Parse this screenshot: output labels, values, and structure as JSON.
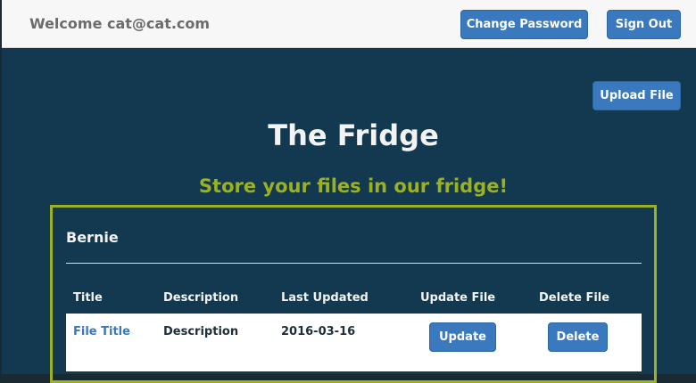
{
  "header": {
    "welcome": "Welcome cat@cat.com",
    "change_password_label": "Change Password",
    "sign_out_label": "Sign Out"
  },
  "main": {
    "upload_label": "Upload File",
    "title": "The Fridge",
    "subtitle": "Store your files in our fridge!"
  },
  "panel": {
    "title": "Bernie",
    "columns": [
      "Title",
      "Description",
      "Last Updated",
      "Update File",
      "Delete File"
    ],
    "rows": [
      {
        "title": "File Title",
        "description": "Description",
        "last_updated": "2016-03-16",
        "update_label": "Update",
        "delete_label": "Delete"
      }
    ]
  },
  "colors": {
    "accent": "#3a79bd",
    "background": "#12394f",
    "highlight": "#9cb11f"
  }
}
